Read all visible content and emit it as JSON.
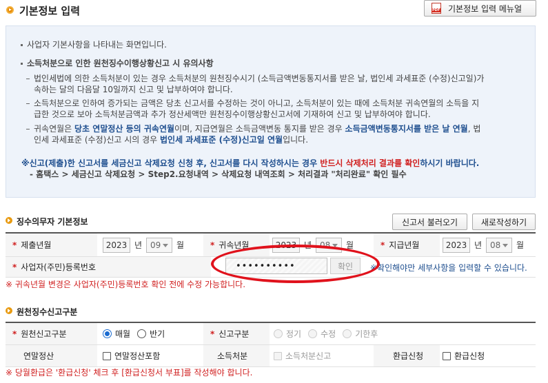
{
  "header": {
    "title": "기본정보 입력",
    "manual_button": "기본정보 입력 메뉴얼"
  },
  "info": {
    "intro": "사업자 기본사항을 나타내는 화면입니다.",
    "caution_title": "소득처분으로 인한 원천징수이행상황신고 시 유의사항",
    "item1_l1": "법인세법에 의한 소득처분이 있는 경우 소득처분의 원천징수시기 (소득금액변동통지서를 받은 날, 법인세 과세표준 (수정)신고일)가",
    "item1_l2": "속하는 달의 다음달 10일까지 신고 및 납부하여야 합니다.",
    "item2_l1": "소득처분으로 인하여 증가되는 금액은 당초 신고서를 수정하는 것이 아니고, 소득처분이 있는 때에 소득처분 귀속연월의 소득을 지",
    "item2_l2": "급한 것으로 보아 소득처분금액과 추가 정산세액만 원천징수이행상황신고서에 기재하여 신고 및 납부하여야 합니다.",
    "item3_l1_a": "귀속연월은 ",
    "item3_l1_b": "당초 연말정산 등의 귀속연월",
    "item3_l1_c": "이며, 지급연월은 소득금액변동 통지를 받은 경우 ",
    "item3_l1_d": "소득금액변동통지서를 받은 날 연월",
    "item3_l1_e": ", 법",
    "item3_l2_a": "인세 과세표준 (수정)신고 시의 경우 ",
    "item3_l2_b": "법인세 과세표준 (수정)신고일 연월",
    "item3_l2_c": "입니다.",
    "notice_a": "※신고(제출)한 신고서를 세금신고 삭제요청 신청 후, 신고서를 다시 작성하시는 경우 ",
    "notice_b": "반드시 삭제처리 결과를 확인",
    "notice_c": "하시기 바랍니다.",
    "notice_path": "- 홈택스 > 세금신고 삭제요청 > Step2.요청내역 > 삭제요청 내역조회 > 처리결과 \"처리완료\" 확인 필수"
  },
  "withholder": {
    "title": "징수의무자 기본정보",
    "load_button": "신고서 불러오기",
    "new_button": "새로작성하기",
    "submit_label": "제출년월",
    "submit_year": "2023",
    "submit_month": "09",
    "attr_label": "귀속년월",
    "attr_year": "2023",
    "attr_month": "08",
    "pay_label": "지급년월",
    "pay_year": "2023",
    "pay_month": "08",
    "unit_year": "년",
    "unit_month": "월",
    "reg_label": "사업자(주민)등록번호",
    "reg_value": "••••••••••",
    "confirm_button": "확인",
    "hint": "※확인해야만 세부사항을 입력할 수 있습니다.",
    "warning": "※ 귀속년월 변경은 사업자(주민)등록번호 확인 전에 수정 가능합니다."
  },
  "category": {
    "title": "원천징수신고구분",
    "type_label": "원천신고구분",
    "opt_monthly": "매월",
    "opt_half": "반기",
    "report_label": "신고구분",
    "opt_regular": "정기",
    "opt_amend": "수정",
    "opt_late": "기한후",
    "yearend_label": "연말정산",
    "yearend_option": "연말정산포함",
    "disposal_label": "소득처분",
    "disposal_option": "소득처분신고",
    "refund_label": "환급신청",
    "refund_option": "환급신청",
    "warning": "※ 당월환급은 '환급신청' 체크 후 [환급신청서 부표]를 작성해야 합니다."
  }
}
